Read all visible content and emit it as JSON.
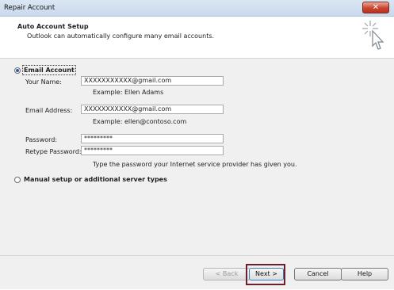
{
  "window": {
    "title": "Repair Account",
    "close_label": "✕"
  },
  "header": {
    "title": "Auto Account Setup",
    "subtitle": "Outlook can automatically configure many email accounts."
  },
  "email_account": {
    "label": "Email Account",
    "selected": true,
    "your_name": {
      "label": "Your Name:",
      "value": "XXXXXXXXXXX@gmail.com",
      "example": "Example: Ellen Adams"
    },
    "email_address": {
      "label": "Email Address:",
      "value": "XXXXXXXXXXX@gmail.com",
      "example": "Example: ellen@contoso.com"
    },
    "password": {
      "label": "Password:",
      "value": "*********"
    },
    "retype_password": {
      "label": "Retype Password:",
      "value": "*********"
    },
    "password_hint": "Type the password your Internet service provider has given you."
  },
  "manual_setup": {
    "label": "Manual setup or additional server types",
    "selected": false
  },
  "footer": {
    "back_label": "< Back",
    "next_label": "Next >",
    "cancel_label": "Cancel",
    "help_label": "Help"
  },
  "colors": {
    "highlight": "#6d1f2e",
    "close_button": "#c9452f",
    "title_bar": "#dbe6f3"
  },
  "icons": {
    "header_icon": "wizard-sparkle-cursor-icon"
  }
}
